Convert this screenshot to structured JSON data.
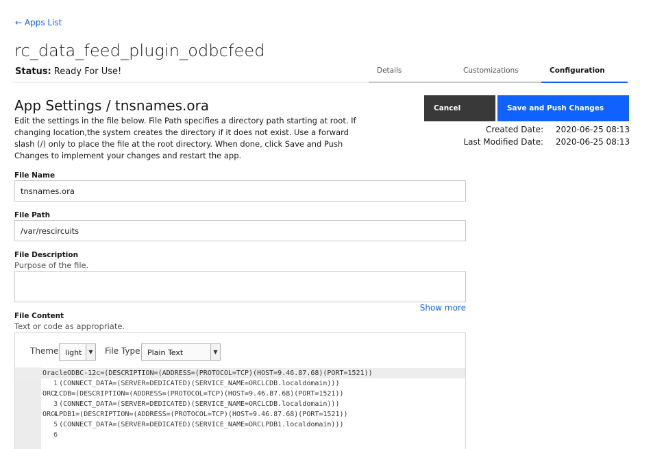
{
  "nav": {
    "back_label": "← Apps List"
  },
  "app": {
    "title": "rc_data_feed_plugin_odbcfeed",
    "status_label": "Status:",
    "status_value": "Ready For Use!"
  },
  "tabs": [
    {
      "label": "Details",
      "active": false
    },
    {
      "label": "Customizations",
      "active": false
    },
    {
      "label": "Configuration",
      "active": true
    }
  ],
  "settings": {
    "title": "App Settings / tnsnames.ora",
    "description": "Edit the settings in the file below. File Path specifies a directory path starting at root. If changing location,the system creates the directory if it does not exist. Use a forward slash (/) only to place the file at the root directory. When done, click Save and Push Changes to implement your changes and restart the app."
  },
  "actions": {
    "cancel_label": "Cancel",
    "save_label": "Save and Push Changes"
  },
  "meta": {
    "created_label": "Created Date:",
    "created_value": "2020-06-25 08:13",
    "modified_label": "Last Modified Date:",
    "modified_value": "2020-06-25 08:13"
  },
  "form": {
    "file_name_label": "File Name",
    "file_name_value": "tnsnames.ora",
    "file_path_label": "File Path",
    "file_path_value": "/var/rescircuits",
    "description_label": "File Description",
    "description_help": "Purpose of the file.",
    "description_value": "",
    "show_more": "Show more",
    "content_label": "File Content",
    "content_help": "Text or code as appropriate."
  },
  "editor": {
    "theme_label": "Theme",
    "theme_value": "light",
    "file_type_label": "File Type",
    "file_type_value": "Plain Text",
    "lines": [
      {
        "num": "1",
        "text": "OracleODBC-12c=(DESCRIPTION=(ADDRESS=(PROTOCOL=TCP)(HOST=9.46.87.68)(PORT=1521))"
      },
      {
        "num": "2",
        "text": "    (CONNECT_DATA=(SERVER=DEDICATED)(SERVICE_NAME=ORCLCDB.localdomain)))"
      },
      {
        "num": "3",
        "text": "ORCLCDB=(DESCRIPTION=(ADDRESS=(PROTOCOL=TCP)(HOST=9.46.87.68)(PORT=1521))"
      },
      {
        "num": "4",
        "text": "    (CONNECT_DATA=(SERVER=DEDICATED)(SERVICE_NAME=ORCLCDB.localdomain)))"
      },
      {
        "num": "5",
        "text": "ORCLPDB1=(DESCRIPTION=(ADDRESS=(PROTOCOL=TCP)(HOST=9.46.87.68)(PORT=1521))"
      },
      {
        "num": "6",
        "text": "    (CONNECT_DATA=(SERVER=DEDICATED)(SERVICE_NAME=ORCLPDB1.localdomain)))"
      }
    ]
  }
}
